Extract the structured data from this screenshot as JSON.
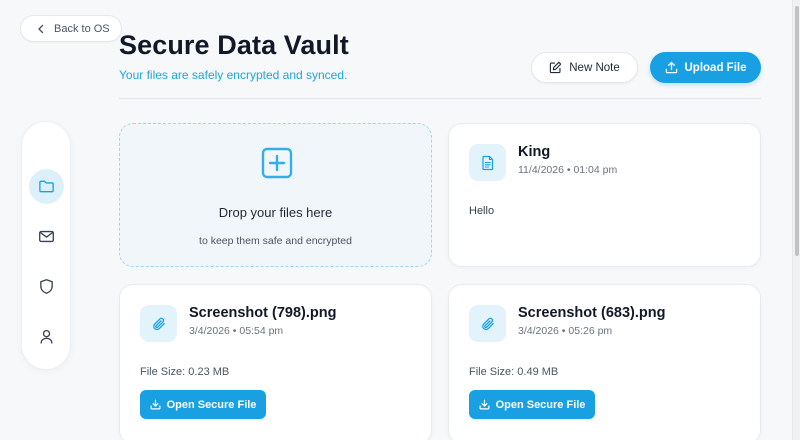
{
  "back": {
    "label": "Back to OS"
  },
  "header": {
    "title": "Secure Data Vault",
    "subtitle": "Your files are safely encrypted and synced.",
    "new_note_label": "New Note",
    "upload_label": "Upload File"
  },
  "sidebar": {
    "items": [
      {
        "name": "files",
        "icon": "folder-icon",
        "active": true
      },
      {
        "name": "mail",
        "icon": "mail-icon",
        "active": false
      },
      {
        "name": "security",
        "icon": "shield-icon",
        "active": false
      },
      {
        "name": "profile",
        "icon": "user-icon",
        "active": false
      }
    ]
  },
  "dropzone": {
    "title": "Drop your files here",
    "subtitle": "to keep them safe and encrypted",
    "icon": "plus-square-icon"
  },
  "items": [
    {
      "type": "note",
      "icon": "document-icon",
      "title": "King",
      "date": "11/4/2026 • 01:04 pm",
      "body": "Hello"
    },
    {
      "type": "file",
      "icon": "paperclip-icon",
      "title": "Screenshot (798).png",
      "date": "3/4/2026 • 05:54 pm",
      "size": "File Size: 0.23 MB",
      "action": "Open Secure File"
    },
    {
      "type": "file",
      "icon": "paperclip-icon",
      "title": "Screenshot (683).png",
      "date": "3/4/2026 • 05:26 pm",
      "size": "File Size: 0.49 MB",
      "action": "Open Secure File"
    }
  ],
  "colors": {
    "accent": "#18a0e3",
    "accent_soft": "#e3f3fc",
    "subtitle": "#1ea5dc",
    "background": "#f6f8fa"
  }
}
